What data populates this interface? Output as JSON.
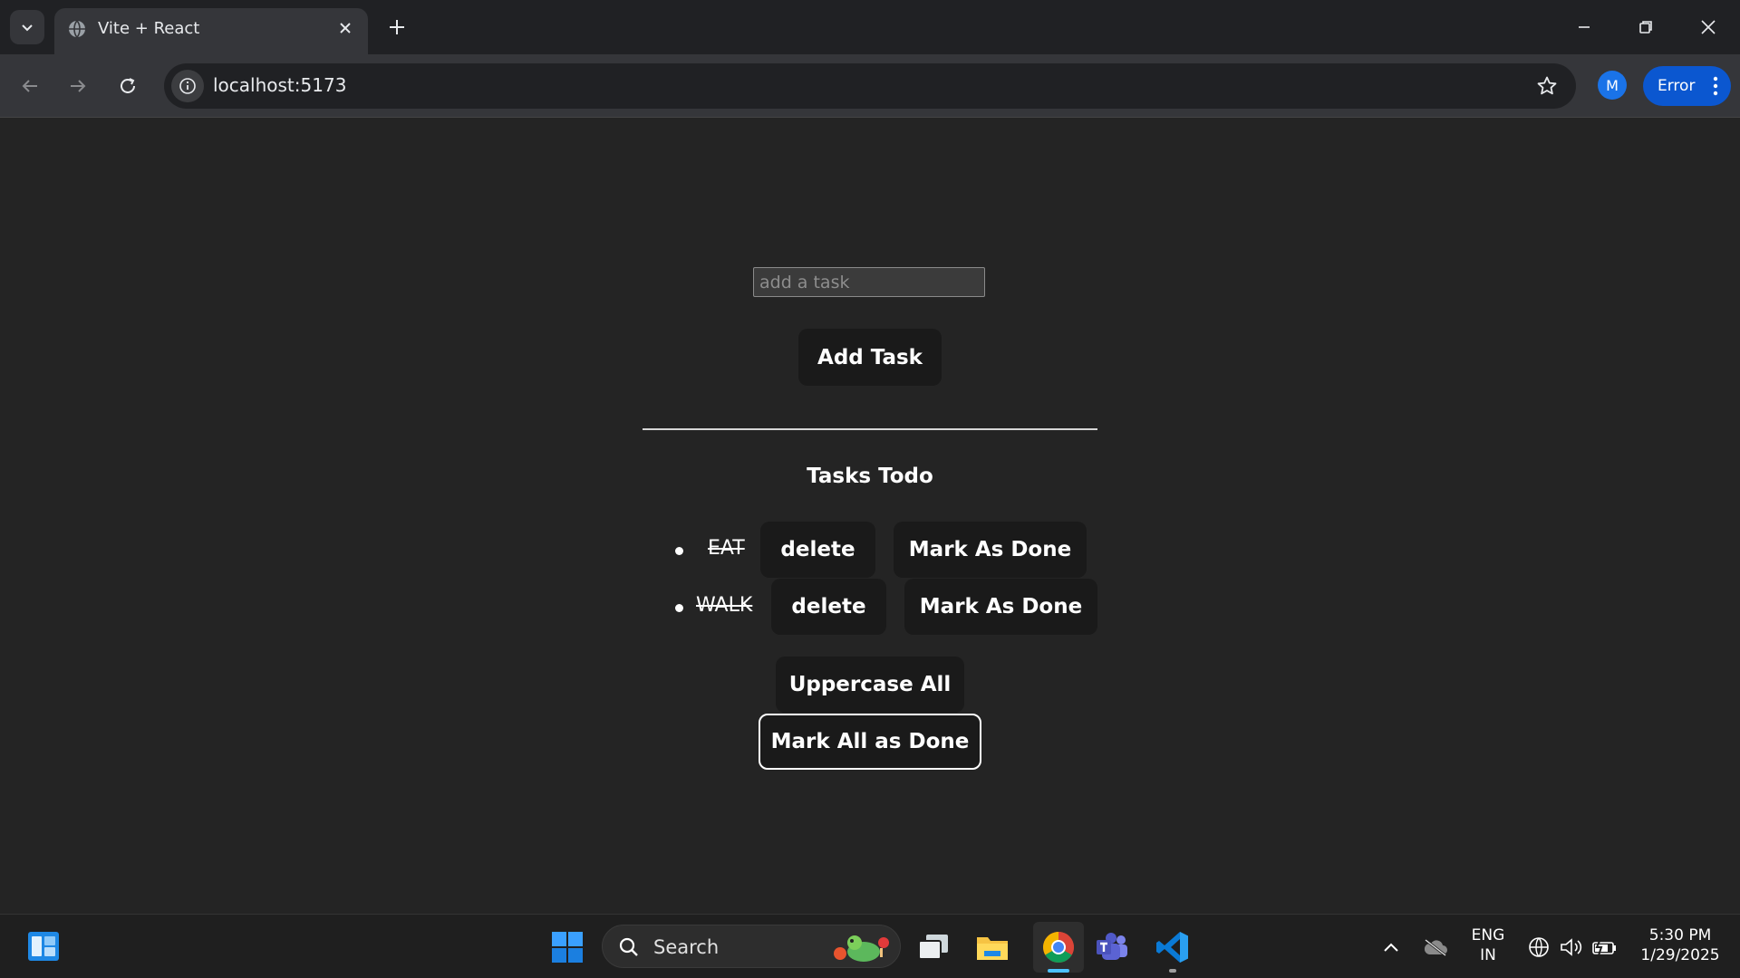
{
  "browser": {
    "tab_title": "Vite + React",
    "url": "localhost:5173",
    "profile_initial": "M",
    "error_label": "Error"
  },
  "app": {
    "input_placeholder": "add a task",
    "add_button": "Add Task",
    "heading": "Tasks Todo",
    "tasks": [
      {
        "text": "EAT",
        "done": true,
        "delete_label": "delete",
        "mark_label": "Mark As Done"
      },
      {
        "text": "WALK",
        "done": true,
        "delete_label": "delete",
        "mark_label": "Mark As Done"
      }
    ],
    "uppercase_button": "Uppercase All",
    "mark_all_button": "Mark All as Done"
  },
  "taskbar": {
    "search_label": "Search",
    "language_line1": "ENG",
    "language_line2": "IN",
    "time": "5:30 PM",
    "date": "1/29/2025"
  },
  "colors": {
    "page_bg": "#242424",
    "button_bg": "#1a1a1a",
    "accent_blue": "#0b57d0"
  }
}
